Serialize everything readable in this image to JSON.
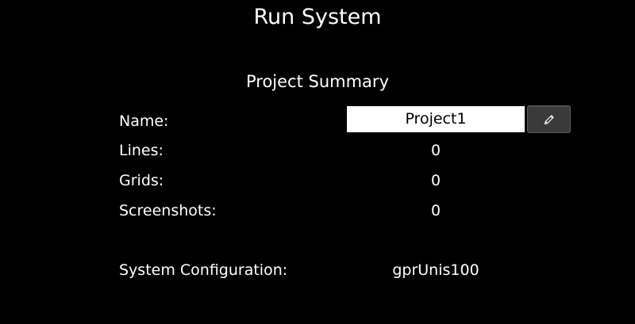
{
  "header": {
    "title": "Run System"
  },
  "summary": {
    "title": "Project Summary",
    "name_label": "Name:",
    "name_value": "Project1",
    "lines_label": "Lines:",
    "lines_value": "0",
    "grids_label": "Grids:",
    "grids_value": "0",
    "screenshots_label": "Screenshots:",
    "screenshots_value": "0",
    "config_label": "System Configuration:",
    "config_value": "gprUnis100"
  },
  "icons": {
    "edit": "pencil-icon"
  },
  "colors": {
    "background": "#000000",
    "text": "#ffffff",
    "field_background": "#ffffff",
    "button_background": "#3a3a3a"
  }
}
